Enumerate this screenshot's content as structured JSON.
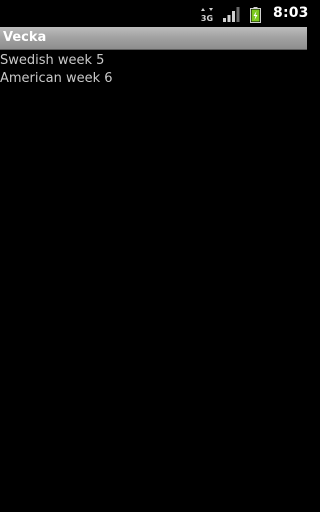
{
  "status_bar": {
    "network_type": "3G",
    "time": "8:03",
    "icons": [
      "network-type-icon",
      "signal-icon",
      "battery-icon"
    ]
  },
  "app": {
    "title": "Vecka"
  },
  "weeks": [
    {
      "text": "Swedish week 5"
    },
    {
      "text": "American week 6"
    }
  ],
  "colors": {
    "background": "#000000",
    "title_bar": "#a3a3a3",
    "text": "#c9c9c9",
    "battery_green": "#7dc91f"
  }
}
